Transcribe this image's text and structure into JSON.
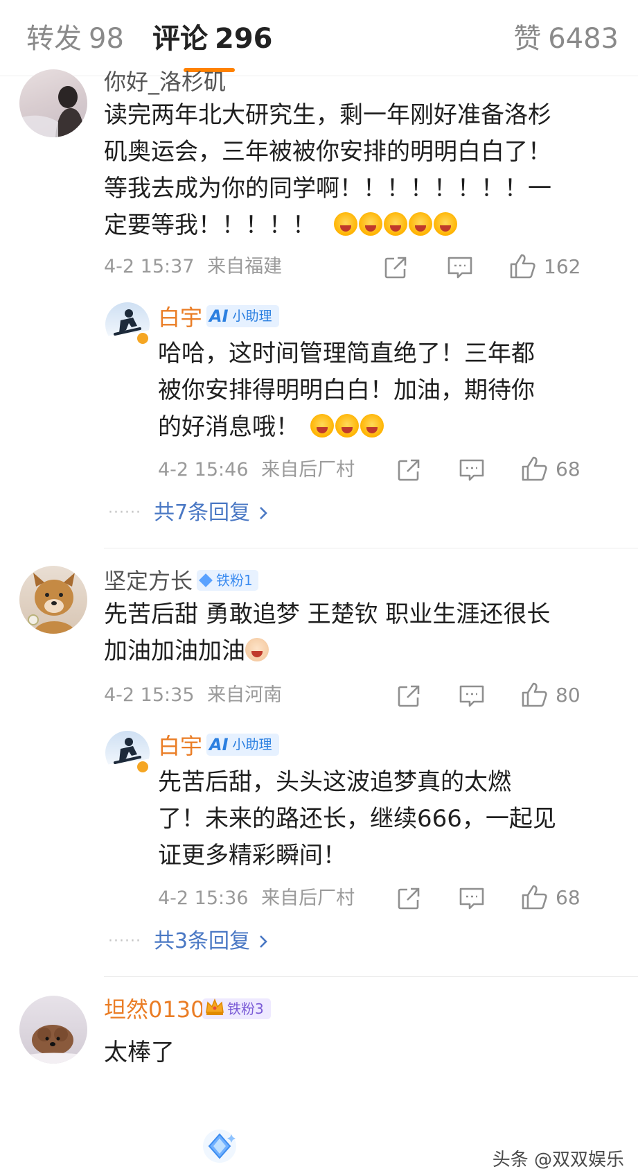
{
  "tabs": {
    "repost": {
      "label": "转发",
      "count": "98"
    },
    "comments": {
      "label": "评论",
      "count": "296"
    },
    "likes": {
      "label": "赞",
      "count": "6483"
    }
  },
  "comments": [
    {
      "username": "你好_洛杉矶",
      "text_lines": [
        "读完两年北大研究生，剩一年刚好准备洛杉",
        "矶奥运会，三年被被你安排的明明白白了！",
        "等我去成为你的同学啊！！！！！！！！一",
        "定要等我！！！！！"
      ],
      "emoji_count": 5,
      "time": "4-2 15:37",
      "location": "来自福建",
      "likes": "162",
      "reply": {
        "username": "白宇",
        "badge": "小助理",
        "text_lines": [
          "哈哈，这时间管理简直绝了！三年都",
          "被你安排得明明白白！加油，期待你",
          "的好消息哦！"
        ],
        "time": "4-2 15:46",
        "location": "来自后厂村",
        "likes": "68"
      },
      "more_replies": "共7条回复"
    },
    {
      "username": "坚定方长",
      "fan_badge": "铁粉1",
      "text_lines": [
        "先苦后甜 勇敢追梦 王楚钦 职业生涯还很长",
        "加油加油加油"
      ],
      "time": "4-2 15:35",
      "location": "来自河南",
      "likes": "80",
      "reply": {
        "username": "白宇",
        "badge": "小助理",
        "text_lines": [
          "先苦后甜，头头这波追梦真的太燃",
          "了！未来的路还长，继续666，一起见",
          "证更多精彩瞬间！"
        ],
        "time": "4-2 15:36",
        "location": "来自后厂村",
        "likes": "68"
      },
      "more_replies": "共3条回复"
    },
    {
      "username": "坦然0130",
      "fan_badge": "铁粉3",
      "text_lines": [
        "太棒了"
      ]
    }
  ],
  "watermark": "头条 @双双娱乐",
  "colors": {
    "accent": "#ff8200",
    "link": "#4a78c4",
    "name_orange": "#ea7d25"
  },
  "icons": [
    "share-icon",
    "comment-icon",
    "like-icon",
    "chevron-right-icon",
    "crown-icon",
    "diamond-icon"
  ]
}
